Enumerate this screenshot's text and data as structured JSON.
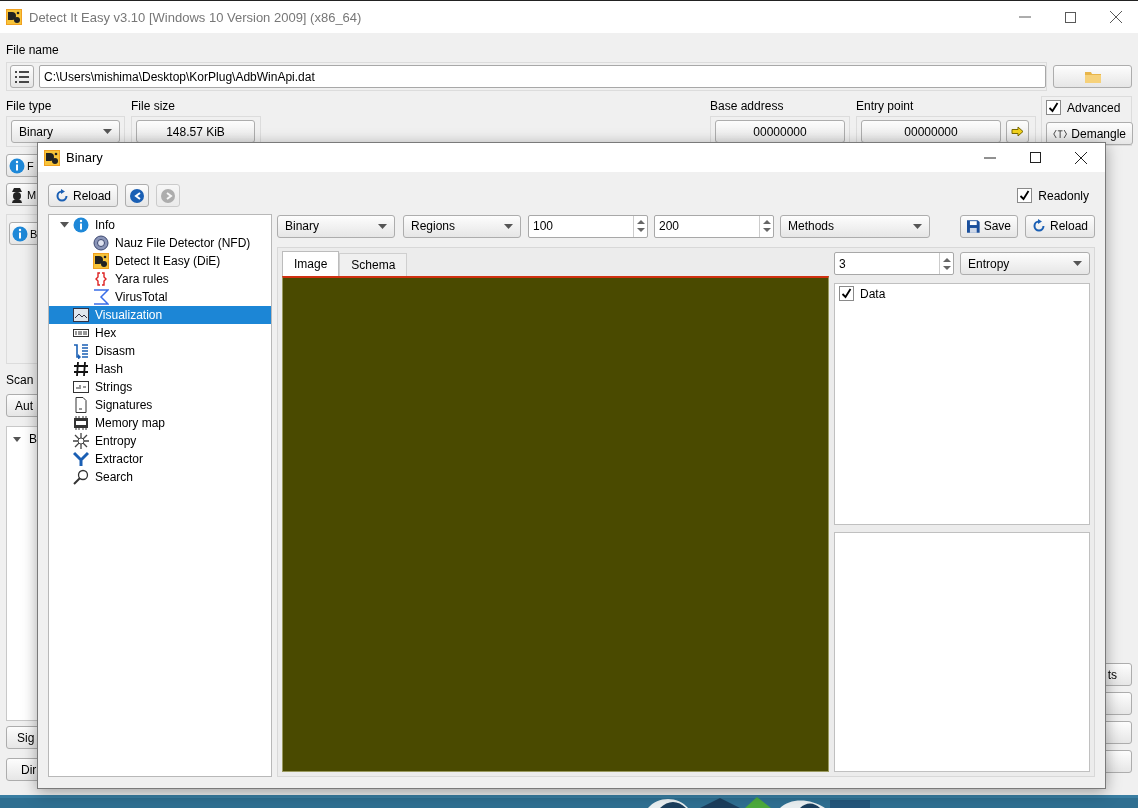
{
  "main_window": {
    "title": "Detect It Easy v3.10 [Windows 10 Version 2009] (x86_64)",
    "file_name_label": "File name",
    "file_path": "C:\\Users\\mishima\\Desktop\\KorPlug\\AdbWinApi.dat",
    "file_type_label": "File type",
    "file_type": "Binary",
    "file_size_label": "File size",
    "file_size": "148.57 KiB",
    "base_address_label": "Base address",
    "base_address": "00000000",
    "entry_point_label": "Entry point",
    "entry_point": "00000000",
    "advanced": {
      "label": "Advanced",
      "checked": true
    },
    "demangle_button": "Demangle",
    "left_buttons": [
      "F",
      "M"
    ],
    "group_button": "B",
    "scan_label": "Scan",
    "scan_mode": "Aut",
    "result_tree": [
      {
        "label": "B",
        "expanded": true
      }
    ],
    "bottom_buttons": [
      "Sig",
      "Dir"
    ],
    "right_buttons": [
      "ts"
    ]
  },
  "dialog": {
    "title": "Binary",
    "reload_button": "Reload",
    "nav_buttons": [
      {
        "kind": "back",
        "disabled": false
      },
      {
        "kind": "forward",
        "disabled": true
      }
    ],
    "readonly": {
      "label": "Readonly",
      "checked": true
    },
    "tree": [
      {
        "label": "Info",
        "selected": false,
        "expanded": true,
        "children": [
          {
            "label": "Nauz File Detector (NFD)",
            "selected": false
          },
          {
            "label": "Detect It Easy (DiE)",
            "selected": false
          },
          {
            "label": "Yara rules",
            "selected": false
          },
          {
            "label": "VirusTotal",
            "selected": false
          }
        ]
      },
      {
        "label": "Visualization",
        "selected": true,
        "expanded": false
      },
      {
        "label": "Hex",
        "selected": false,
        "expanded": false
      },
      {
        "label": "Disasm",
        "selected": false,
        "expanded": false
      },
      {
        "label": "Hash",
        "selected": false,
        "expanded": false
      },
      {
        "label": "Strings",
        "selected": false,
        "expanded": false
      },
      {
        "label": "Signatures",
        "selected": false,
        "expanded": false
      },
      {
        "label": "Memory map",
        "selected": false,
        "expanded": false
      },
      {
        "label": "Entropy",
        "selected": false,
        "expanded": false
      },
      {
        "label": "Extractor",
        "selected": false,
        "expanded": false
      },
      {
        "label": "Search",
        "selected": false,
        "expanded": false
      }
    ],
    "type_combo": "Binary",
    "mode_combo": "Regions",
    "width_spin": "100",
    "height_spin": "200",
    "method_combo": "Methods",
    "save_button": "Save",
    "reload_button_2": "Reload",
    "tabs": [
      {
        "label": "Image",
        "selected": true
      },
      {
        "label": "Schema",
        "selected": false
      }
    ],
    "scale_spin": "3",
    "view_combo": "Entropy",
    "layers": [
      {
        "label": "Data",
        "checked": true
      }
    ]
  }
}
